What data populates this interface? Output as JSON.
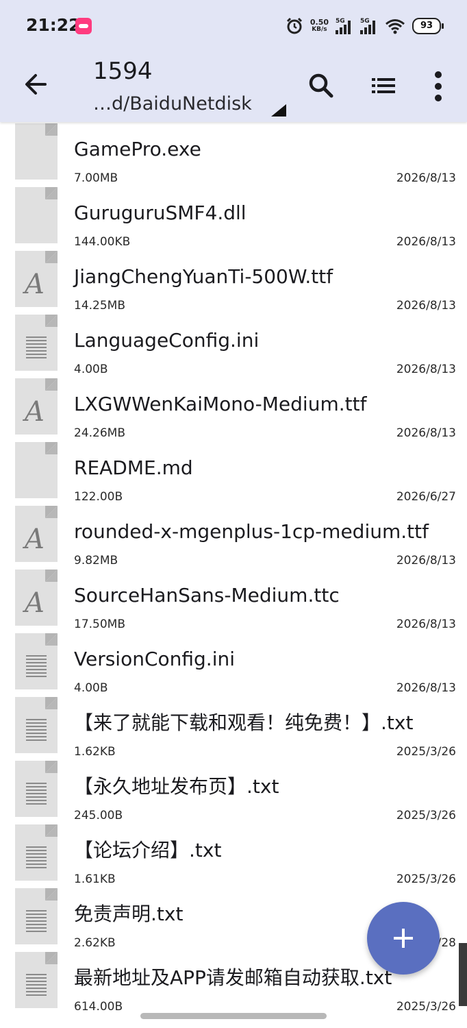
{
  "status": {
    "time": "21:22",
    "speed_value": "0.50",
    "speed_unit": "KB/s",
    "sim1": "5G",
    "sim2": "5G",
    "battery": "93"
  },
  "appbar": {
    "title": "1594",
    "path": "…d/BaiduNetdisk"
  },
  "files": [
    {
      "name": "GamePro.exe",
      "size": "7.00MB",
      "date": "2026/8/13",
      "icon": "blank"
    },
    {
      "name": "GuruguruSMF4.dll",
      "size": "144.00KB",
      "date": "2026/8/13",
      "icon": "blank"
    },
    {
      "name": "JiangChengYuanTi-500W.ttf",
      "size": "14.25MB",
      "date": "2026/8/13",
      "icon": "font"
    },
    {
      "name": "LanguageConfig.ini",
      "size": "4.00B",
      "date": "2026/8/13",
      "icon": "text"
    },
    {
      "name": "LXGWWenKaiMono-Medium.ttf",
      "size": "24.26MB",
      "date": "2026/8/13",
      "icon": "font"
    },
    {
      "name": "README.md",
      "size": "122.00B",
      "date": "2026/6/27",
      "icon": "blank"
    },
    {
      "name": "rounded-x-mgenplus-1cp-medium.ttf",
      "size": "9.82MB",
      "date": "2026/8/13",
      "icon": "font"
    },
    {
      "name": "SourceHanSans-Medium.ttc",
      "size": "17.50MB",
      "date": "2026/8/13",
      "icon": "font"
    },
    {
      "name": "VersionConfig.ini",
      "size": "4.00B",
      "date": "2026/8/13",
      "icon": "text"
    },
    {
      "name": "【来了就能下载和观看！纯免费！】.txt",
      "size": "1.62KB",
      "date": "2025/3/26",
      "icon": "text"
    },
    {
      "name": "【永久地址发布页】.txt",
      "size": "245.00B",
      "date": "2025/3/26",
      "icon": "text"
    },
    {
      "name": "【论坛介绍】.txt",
      "size": "1.61KB",
      "date": "2025/3/26",
      "icon": "text"
    },
    {
      "name": "免责声明.txt",
      "size": "2.62KB",
      "date": "2025/3/28",
      "icon": "text"
    },
    {
      "name": "最新地址及APP请发邮箱自动获取.txt",
      "size": "614.00B",
      "date": "2025/3/26",
      "icon": "text"
    }
  ],
  "font_icon_letter": "A",
  "colors": {
    "appbar_bg": "#e2e5f5",
    "fab": "#5a6fc0",
    "icon_bg": "#e0e0e0"
  }
}
